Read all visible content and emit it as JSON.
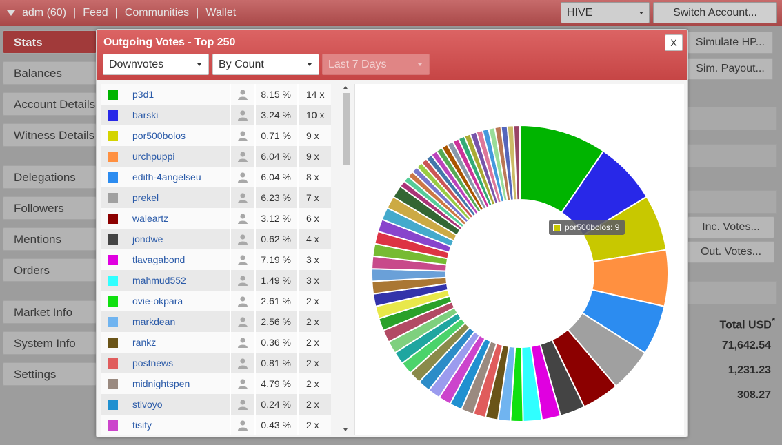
{
  "topbar": {
    "user": "adm (60)",
    "nav": [
      "Feed",
      "Communities",
      "Wallet"
    ],
    "separator": "|",
    "chain_select": "HIVE",
    "switch_account": "Switch Account..."
  },
  "sidebar": {
    "items": [
      "Stats",
      "Balances",
      "Account Details",
      "Witness Details",
      "Delegations",
      "Followers",
      "Mentions",
      "Orders",
      "Market Info",
      "System Info",
      "Settings"
    ]
  },
  "right_panel": {
    "simulate_hp": "Simulate HP...",
    "sim_payout": "Sim. Payout...",
    "inc_votes": "Inc. Votes...",
    "out_votes": "Out. Votes...",
    "total_usd": "Total USD",
    "total_marker": "*",
    "values": [
      "71,642.54",
      "1,231.23",
      "308.27"
    ]
  },
  "modal": {
    "title": "Outgoing Votes - Top 250",
    "close": "X",
    "type_select": "Downvotes",
    "sort_select": "By Count",
    "period_select": "Last 7 Days",
    "rows": [
      {
        "name": "p3d1",
        "pct": "8.15 %",
        "count": "14 x",
        "color": "#00b400"
      },
      {
        "name": "barski",
        "pct": "3.24 %",
        "count": "10 x",
        "color": "#2828e8"
      },
      {
        "name": "por500bolos",
        "pct": "0.71 %",
        "count": "9 x",
        "color": "#d4d400"
      },
      {
        "name": "urchpuppi",
        "pct": "6.04 %",
        "count": "9 x",
        "color": "#ff9040"
      },
      {
        "name": "edith-4angelseu",
        "pct": "6.04 %",
        "count": "8 x",
        "color": "#2c8cf0"
      },
      {
        "name": "prekel",
        "pct": "6.23 %",
        "count": "7 x",
        "color": "#a0a0a0"
      },
      {
        "name": "waleartz",
        "pct": "3.12 %",
        "count": "6 x",
        "color": "#8c0000"
      },
      {
        "name": "jondwe",
        "pct": "0.62 %",
        "count": "4 x",
        "color": "#444444"
      },
      {
        "name": "tlavagabond",
        "pct": "7.19 %",
        "count": "3 x",
        "color": "#e000e0"
      },
      {
        "name": "mahmud552",
        "pct": "1.49 %",
        "count": "3 x",
        "color": "#30ffff"
      },
      {
        "name": "ovie-okpara",
        "pct": "2.61 %",
        "count": "2 x",
        "color": "#10e010"
      },
      {
        "name": "markdean",
        "pct": "2.56 %",
        "count": "2 x",
        "color": "#70b4f0"
      },
      {
        "name": "rankz",
        "pct": "0.36 %",
        "count": "2 x",
        "color": "#6a5418"
      },
      {
        "name": "postnews",
        "pct": "0.81 %",
        "count": "2 x",
        "color": "#e05c5c"
      },
      {
        "name": "midnightspen",
        "pct": "4.79 %",
        "count": "2 x",
        "color": "#9a8a80"
      },
      {
        "name": "stivoyo",
        "pct": "0.24 %",
        "count": "2 x",
        "color": "#2090d0"
      },
      {
        "name": "tisify",
        "pct": "0.43 %",
        "count": "2 x",
        "color": "#cc44cc"
      }
    ],
    "tooltip": "por500bolos: 9"
  },
  "chart_data": {
    "type": "pie",
    "title": "",
    "style": "donut",
    "labels": [
      "p3d1",
      "barski",
      "por500bolos",
      "urchpuppi",
      "edith-4angelseu",
      "prekel",
      "waleartz",
      "jondwe",
      "tlavagabond",
      "mahmud552",
      "ovie-okpara",
      "markdean",
      "rankz",
      "postnews",
      "midnightspen",
      "stivoyo",
      "tisify"
    ],
    "values": [
      14,
      10,
      9,
      9,
      8,
      7,
      6,
      4,
      3,
      3,
      2,
      2,
      2,
      2,
      2,
      2,
      2
    ],
    "colors": [
      "#00b400",
      "#2828e8",
      "#c8c800",
      "#ff9040",
      "#2c8cf0",
      "#a0a0a0",
      "#8c0000",
      "#444444",
      "#e000e0",
      "#30ffff",
      "#10e010",
      "#70b4f0",
      "#6a5418",
      "#e05c5c",
      "#9a8a80",
      "#2090d0",
      "#cc44cc"
    ],
    "unlisted_slices": {
      "values": [
        2,
        2,
        2,
        2,
        2,
        2,
        2,
        2,
        2,
        2,
        2,
        2,
        2,
        2,
        2,
        2,
        2,
        2,
        2,
        1,
        1,
        1,
        1,
        1,
        1,
        1,
        1,
        1,
        1,
        1,
        1,
        1,
        1,
        1,
        1,
        1,
        1,
        1,
        1,
        1,
        1
      ],
      "colors": [
        "#9b9bee",
        "#2c8cc8",
        "#8a8a4a",
        "#4bd36b",
        "#1fa6a0",
        "#7ed07e",
        "#b24a64",
        "#2aa12a",
        "#e8e84a",
        "#3333aa",
        "#aa7733",
        "#6aa0d8",
        "#c84a8a",
        "#77bb33",
        "#dd3344",
        "#8844cc",
        "#44aacc",
        "#ccaa44",
        "#336633",
        "#aa3377",
        "#55cc99",
        "#cc7744",
        "#7777cc",
        "#99cc44",
        "#cc5555",
        "#4477aa",
        "#bb44bb",
        "#55aa55",
        "#aa5500",
        "#8899aa",
        "#cc3399",
        "#33aa77",
        "#aaaa33",
        "#7755aa",
        "#dd7799",
        "#4499dd",
        "#99dd99",
        "#bb7755",
        "#5566bb",
        "#ccbb66",
        "#994466"
      ]
    }
  }
}
